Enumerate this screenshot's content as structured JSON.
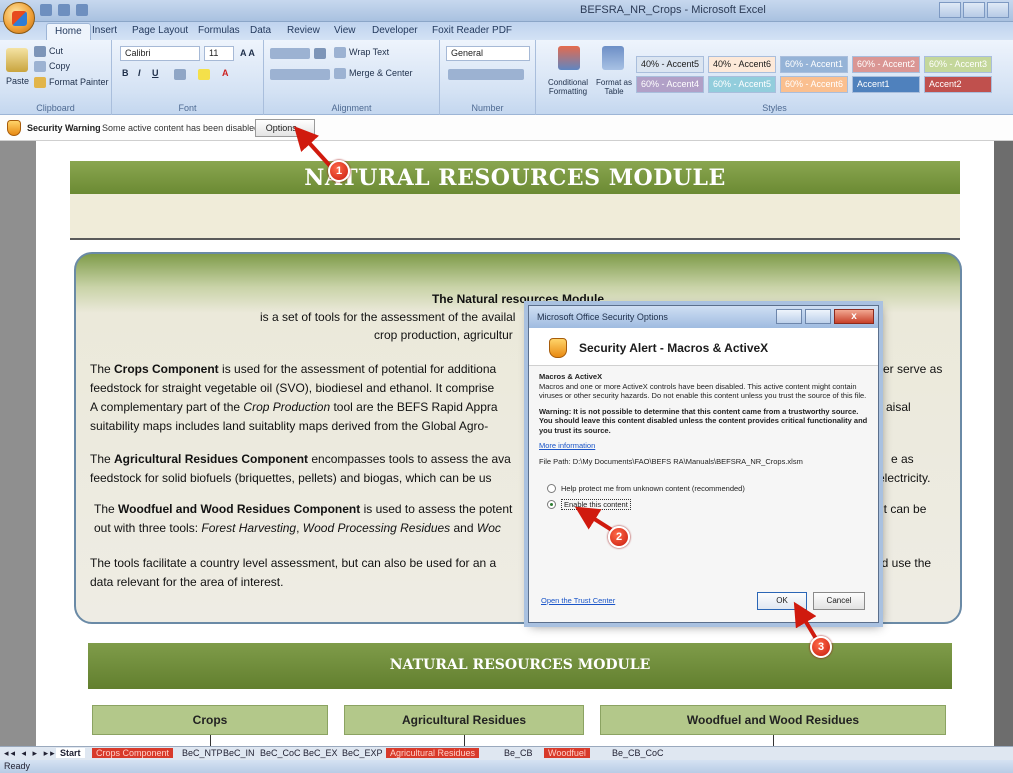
{
  "window": {
    "title": "BEFSRA_NR_Crops - Microsoft Excel",
    "tabs": [
      "Home",
      "Insert",
      "Page Layout",
      "Formulas",
      "Data",
      "Review",
      "View",
      "Developer",
      "Foxit Reader PDF"
    ]
  },
  "ribbon": {
    "clipboard": {
      "paste": "Paste",
      "cut": "Cut",
      "copy": "Copy",
      "format_painter": "Format Painter",
      "label": "Clipboard"
    },
    "font": {
      "name": "Calibri",
      "size": "11",
      "label": "Font"
    },
    "alignment": {
      "wrap_text": "Wrap Text",
      "merge_center": "Merge & Center",
      "label": "Alignment"
    },
    "number": {
      "format": "General",
      "label": "Number"
    },
    "styles": {
      "conditional": "Conditional Formatting",
      "format_table": "Format as Table",
      "cells": [
        "40% - Accent5",
        "40% - Accent6",
        "60% - Accent1",
        "60% - Accent2",
        "60% - Accent3",
        "60% - Accent4",
        "60% - Accent5",
        "60% - Accent6",
        "Accent1",
        "Accent2"
      ],
      "label": "Styles"
    }
  },
  "security_bar": {
    "title": "Security Warning",
    "message": "Some active content has been disabled.",
    "options_button": "Options..."
  },
  "sheet": {
    "banner_title": "NATURAL RESOURCES MODULE",
    "panel": {
      "heading": "The Natural resources Module",
      "line1": "is a set of tools for the assessment of the availal",
      "line2": "crop production, agricultur",
      "crops_para": {
        "a1": "The ",
        "a_bold": "Crops Component",
        "a2": " is used for the assessment of potential for additiona",
        "b": "feedstock for straight vegetable oil (SVO),  biodiesel and ethanol. It comprise",
        "c1": "A complementary part of the ",
        "c_ital": "Crop Production",
        "c2": " tool are the BEFS Rapid Appra",
        "d": "suitability maps includes land suitablity maps derived from the Global Agro-",
        "r_a": "iter serve as",
        "r_c": "aisal"
      },
      "residues_para": {
        "a1": "The ",
        "a_bold": "Agricultural Residues Component",
        "a2": " encompasses tools to assess the ava",
        "b": "feedstock for solid biofuels (briquettes, pellets) and biogas, which can be us",
        "r_a": "e as",
        "r_b": "electricity."
      },
      "wood_para": {
        "a1": "The ",
        "a_bold": "Woodfuel and Wood Residues Component",
        "a2": " is used to assess the potent",
        "b1": "out with three tools: ",
        "b_ital1": "Forest Harvesting",
        "b2": ", ",
        "b_ital2": "Wood Processing Residues",
        "b3": " and ",
        "b_ital3": "Woc",
        "r_a": "it can be"
      },
      "tools_para": {
        "a": "The tools facilitate a country level assessment, but can also be used for an a",
        "b": "data relevant for the area of interest.",
        "r_a": "ld use the"
      }
    },
    "bottom_banner": "NATURAL RESOURCES MODULE",
    "components": [
      "Crops",
      "Agricultural Residues",
      "Woodfuel and Wood Residues"
    ]
  },
  "sheet_tabs": [
    "Start",
    "Crops Component",
    "BeC_NTP",
    "BeC_IN",
    "BeC_CoC",
    "BeC_EX",
    "BeC_EXP",
    "Agricultural Residues",
    "Be_CB",
    "Woodfuel",
    "Be_CB_CoC"
  ],
  "status": "Ready",
  "dialog": {
    "title": "Microsoft Office Security Options",
    "close": "x",
    "heading": "Security Alert - Macros & ActiveX",
    "section": "Macros & ActiveX",
    "desc": "Macros and one or more ActiveX controls have been disabled. This active content might contain viruses or other security hazards. Do not enable this content unless you trust the source of this file.",
    "warning": "Warning: It is not possible to determine that this content came from a trustworthy source. You should leave this content disabled unless the content provides critical functionality and you trust its source.",
    "more_info": "More information",
    "file_path": "File Path:  D:\\My Documents\\FAO\\BEFS RA\\Manuals\\BEFSRA_NR_Crops.xlsm",
    "option_protect": "Help protect me from unknown content (recommended)",
    "option_enable": "Enable this content",
    "trust_center": "Open the Trust Center",
    "ok": "OK",
    "cancel": "Cancel"
  },
  "callouts": [
    "1",
    "2",
    "3"
  ],
  "colors": {
    "banner": "#6b8a33",
    "callout": "#c81a0c",
    "ribbon": "#d4e2f4"
  }
}
